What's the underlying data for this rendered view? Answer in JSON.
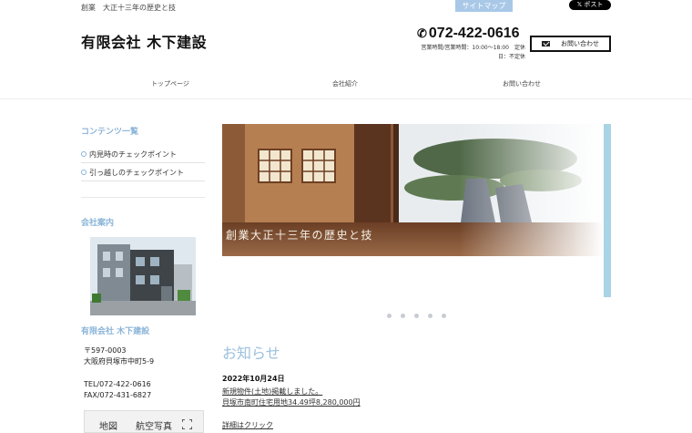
{
  "header": {
    "tagline": "創業　大正十三年の歴史と技",
    "sitemap_label": "サイトマップ",
    "x_post_label": "𝕏 ポスト",
    "company_name": "有限会社 木下建設",
    "phone": "072-422-0616",
    "hours_line1": "営業時間/営業時間：10:00～18:00　定休",
    "hours_line2": "日：不定休",
    "contact_label": "お問い合わせ"
  },
  "nav": {
    "items": [
      "トップページ",
      "会社紹介",
      "お問い合わせ"
    ]
  },
  "sidebar": {
    "contents_heading": "コンテンツ一覧",
    "items": [
      "内見時のチェックポイント",
      "引っ越しのチェックポイント"
    ],
    "company_heading": "会社案内",
    "company_name": "有限会社 木下建設",
    "postal": "〒597-0003",
    "address": "大阪府貝塚市中町5-9",
    "tel": "TEL/072-422-0616",
    "fax": "FAX/072-431-6827",
    "map_tab_map": "地図",
    "map_tab_aerial": "航空写真"
  },
  "slider": {
    "caption": "創業大正十三年の歴史と技",
    "slide_count": 5
  },
  "news": {
    "heading": "お知らせ",
    "date": "2022年10月24日",
    "line1": "新規物件(土地)掲載しました。",
    "line2": "貝塚市南町住宅用地34.49坪8,280,000円",
    "more": "詳細はクリック"
  },
  "colors": {
    "accent": "#8ab4d8",
    "sitemap": "#a9c8e8",
    "slider_edge": "#a9d4e6"
  }
}
